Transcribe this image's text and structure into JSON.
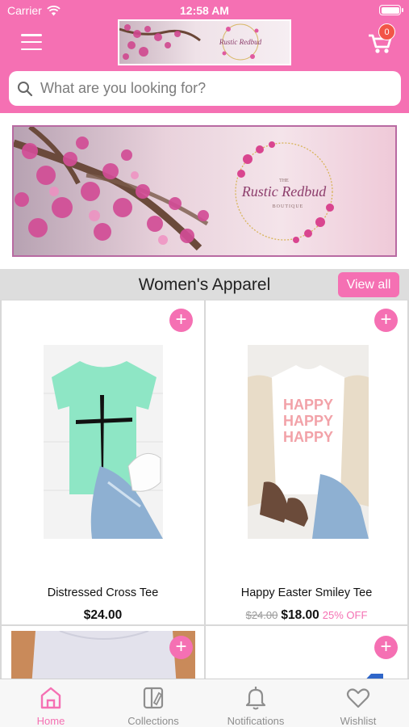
{
  "status_bar": {
    "carrier": "Carrier",
    "time": "12:58 AM"
  },
  "header": {
    "logo_alt": "The Rustic Redbud Boutique",
    "cart_count": "0",
    "search_placeholder": "What are you looking for?"
  },
  "banner": {
    "brand_small": "THE",
    "brand_name": "Rustic Redbud",
    "brand_sub": "BOUTIQUE"
  },
  "section": {
    "title": "Women's Apparel",
    "view_all": "View all"
  },
  "products": [
    {
      "name": "Distressed Cross Tee",
      "price": "$24.00",
      "old_price": "",
      "discount": ""
    },
    {
      "name": "Happy Easter Smiley Tee",
      "price": "$18.00",
      "old_price": "$24.00",
      "discount": "25% OFF"
    }
  ],
  "tabs": [
    {
      "label": "Home",
      "icon": "home-icon",
      "active": true
    },
    {
      "label": "Collections",
      "icon": "collections-icon",
      "active": false
    },
    {
      "label": "Notifications",
      "icon": "bell-icon",
      "active": false
    },
    {
      "label": "Wishlist",
      "icon": "heart-icon",
      "active": false
    }
  ],
  "colors": {
    "brand_pink": "#f570b3",
    "badge_red": "#f25548",
    "section_gray": "#dddddd"
  }
}
